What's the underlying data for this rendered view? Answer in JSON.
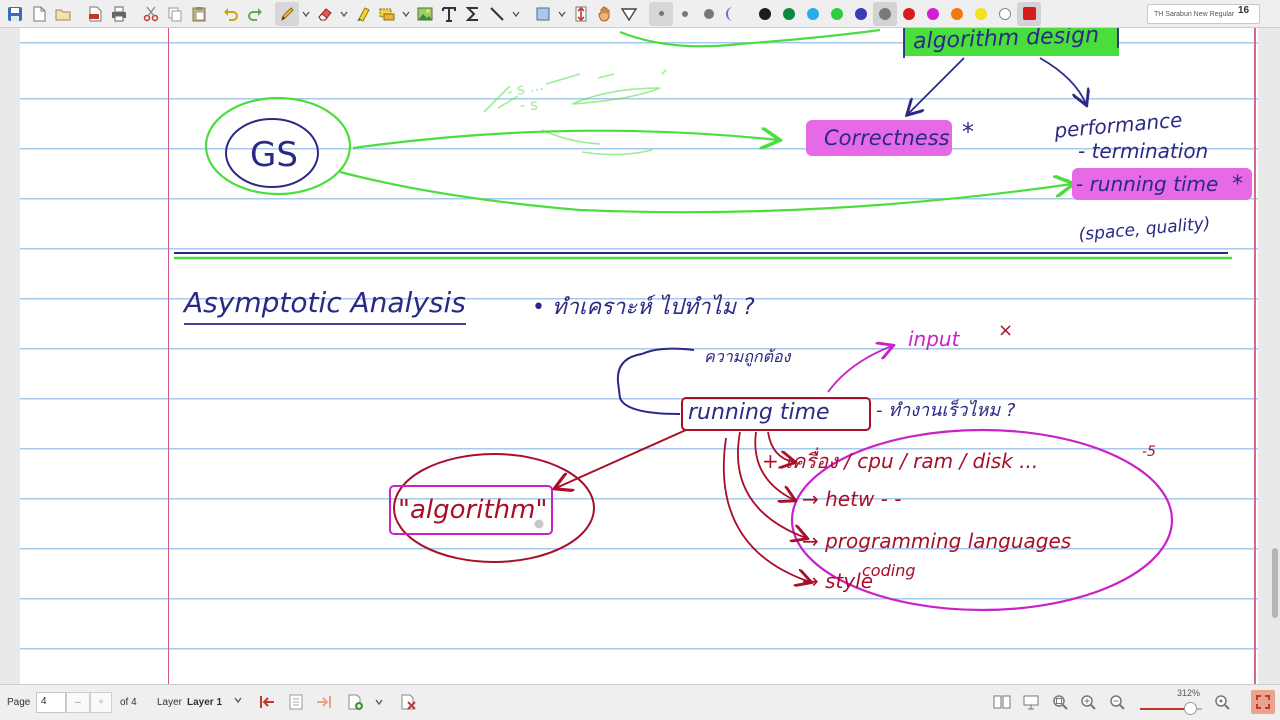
{
  "toolbar": {
    "icons": [
      {
        "name": "save-icon",
        "color": "#3a6fb5"
      },
      {
        "name": "new-note-icon"
      },
      {
        "name": "open-folder-icon"
      },
      {
        "name": "export-pdf-icon",
        "color": "#c0392b"
      },
      {
        "name": "print-icon"
      },
      {
        "name": "cut-icon",
        "color": "#c0392b"
      },
      {
        "name": "copy-icon"
      },
      {
        "name": "paste-icon"
      },
      {
        "name": "undo-icon",
        "color": "#d4a017"
      },
      {
        "name": "redo-icon",
        "color": "#6aa84f"
      },
      {
        "name": "pen-tool-icon"
      },
      {
        "name": "eraser-icon"
      },
      {
        "name": "highlighter-icon"
      },
      {
        "name": "select-region-icon"
      },
      {
        "name": "image-icon"
      },
      {
        "name": "text-tool-icon"
      },
      {
        "name": "math-tex-icon"
      },
      {
        "name": "line-tool-icon"
      },
      {
        "name": "shape-icon"
      },
      {
        "name": "vertical-space-icon"
      },
      {
        "name": "hand-tool-icon"
      },
      {
        "name": "filter-icon"
      },
      {
        "name": "fine-pen-icon"
      },
      {
        "name": "medium-pen-icon"
      },
      {
        "name": "thick-pen-icon"
      },
      {
        "name": "fill-icon"
      }
    ],
    "colors": [
      "#1c1c1c",
      "#0b8a3e",
      "#27aee8",
      "#2ecc40",
      "#3a3ab5",
      "#7a7a7a",
      "#d81b1b",
      "#d01fd0",
      "#f07a10",
      "#f2e21c",
      "#ffffff",
      "#d81b1b"
    ],
    "selected_color": "#d81b1b",
    "font_name": "TH Sarabun New Regular",
    "font_size": "16"
  },
  "note": {
    "top_section": {
      "algorithm_design": "algorithm design",
      "gs": "GS",
      "correctness": "Correctness",
      "correctness_mark": "*",
      "performance": "performance",
      "termination": "- termination",
      "running_time": "- running time",
      "running_time_mark": "*",
      "space_quality": "(space, quality)",
      "faint_sketch_1": "- s ...",
      "faint_sketch_2": "- s"
    },
    "bottom_section": {
      "heading": "Asymptotic Analysis",
      "question": "• ทำเคราะห์ ไปทำไม ?",
      "correctness_thai": "ความถูกต้อง",
      "running_time": "running time",
      "question2": "- ทำงานเร็วไหม ?",
      "input": "input",
      "cross_mark": "×",
      "algorithm": "\"algorithm\"",
      "factor_1": "+ เครื่อง / cpu / ram / disk ...",
      "factor_1_tail": "-5",
      "factor_2": "→ hetw - -",
      "factor_3": "→ programming languages",
      "factor_4": "→ style",
      "factor_4_sup": "coding"
    },
    "colors": {
      "ink_blue": "#2a2a86",
      "ink_green": "#4ade3d",
      "ink_red": "#a8102a",
      "ink_magenta": "#c922c9",
      "highlight_green": "#4ade3d",
      "highlight_magenta": "#e66ae6"
    }
  },
  "status": {
    "page_label": "Page",
    "page_value": "4",
    "page_minus": "–",
    "page_plus": "+",
    "page_total": "of 4",
    "layer_label": "Layer",
    "layer_value": "Layer 1",
    "zoom": "312%",
    "zoom_level": 0.72,
    "icons": [
      "go-first-page-icon",
      "page-up-icon",
      "go-last-page-icon",
      "add-page-icon",
      "page-options-chevron-icon",
      "delete-page-icon",
      "two-page-view-icon",
      "presentation-icon",
      "zoom-fit-icon",
      "zoom-in-icon",
      "zoom-out-icon",
      "zoom-reset-icon",
      "fullscreen-icon"
    ]
  }
}
